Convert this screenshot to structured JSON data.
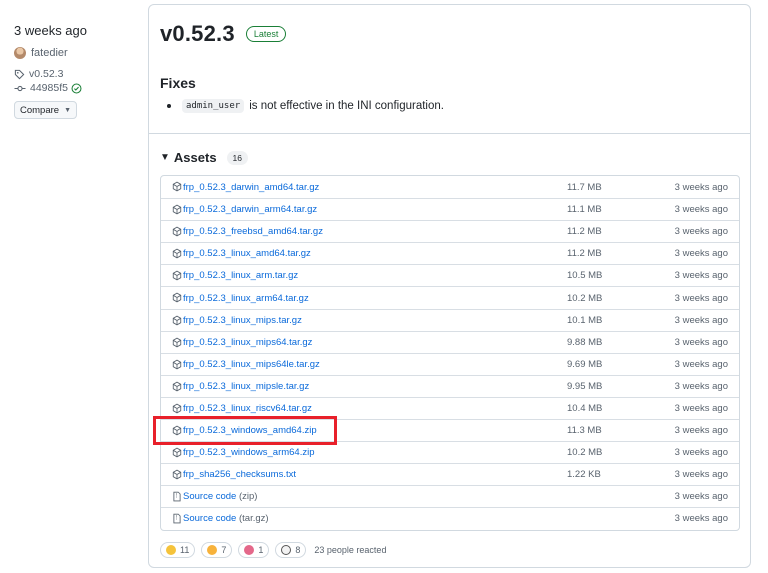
{
  "sidebar": {
    "time": "3 weeks ago",
    "author": "fatedier",
    "tag": "v0.52.3",
    "commit": "44985f5",
    "compare_label": "Compare"
  },
  "release": {
    "version": "v0.52.3",
    "latest_badge": "Latest",
    "section_title": "Fixes",
    "fix_code": "admin_user",
    "fix_text": "is not effective in the INI configuration."
  },
  "assets": {
    "title": "Assets",
    "count": "16",
    "rows": [
      {
        "name": "frp_0.52.3_darwin_amd64.tar.gz",
        "sub": "",
        "size": "11.7 MB",
        "when": "3 weeks ago",
        "icon": "package-icon"
      },
      {
        "name": "frp_0.52.3_darwin_arm64.tar.gz",
        "sub": "",
        "size": "11.1 MB",
        "when": "3 weeks ago",
        "icon": "package-icon"
      },
      {
        "name": "frp_0.52.3_freebsd_amd64.tar.gz",
        "sub": "",
        "size": "11.2 MB",
        "when": "3 weeks ago",
        "icon": "package-icon"
      },
      {
        "name": "frp_0.52.3_linux_amd64.tar.gz",
        "sub": "",
        "size": "11.2 MB",
        "when": "3 weeks ago",
        "icon": "package-icon"
      },
      {
        "name": "frp_0.52.3_linux_arm.tar.gz",
        "sub": "",
        "size": "10.5 MB",
        "when": "3 weeks ago",
        "icon": "package-icon"
      },
      {
        "name": "frp_0.52.3_linux_arm64.tar.gz",
        "sub": "",
        "size": "10.2 MB",
        "when": "3 weeks ago",
        "icon": "package-icon"
      },
      {
        "name": "frp_0.52.3_linux_mips.tar.gz",
        "sub": "",
        "size": "10.1 MB",
        "when": "3 weeks ago",
        "icon": "package-icon"
      },
      {
        "name": "frp_0.52.3_linux_mips64.tar.gz",
        "sub": "",
        "size": "9.88 MB",
        "when": "3 weeks ago",
        "icon": "package-icon"
      },
      {
        "name": "frp_0.52.3_linux_mips64le.tar.gz",
        "sub": "",
        "size": "9.69 MB",
        "when": "3 weeks ago",
        "icon": "package-icon"
      },
      {
        "name": "frp_0.52.3_linux_mipsle.tar.gz",
        "sub": "",
        "size": "9.95 MB",
        "when": "3 weeks ago",
        "icon": "package-icon"
      },
      {
        "name": "frp_0.52.3_linux_riscv64.tar.gz",
        "sub": "",
        "size": "10.4 MB",
        "when": "3 weeks ago",
        "icon": "package-icon"
      },
      {
        "name": "frp_0.52.3_windows_amd64.zip",
        "sub": "",
        "size": "11.3 MB",
        "when": "3 weeks ago",
        "icon": "package-icon"
      },
      {
        "name": "frp_0.52.3_windows_arm64.zip",
        "sub": "",
        "size": "10.2 MB",
        "when": "3 weeks ago",
        "icon": "package-icon"
      },
      {
        "name": "frp_sha256_checksums.txt",
        "sub": "",
        "size": "1.22 KB",
        "when": "3 weeks ago",
        "icon": "package-icon"
      },
      {
        "name": "Source code",
        "sub": "(zip)",
        "size": "",
        "when": "3 weeks ago",
        "icon": "file-zip-icon"
      },
      {
        "name": "Source code",
        "sub": "(tar.gz)",
        "size": "",
        "when": "3 weeks ago",
        "icon": "file-zip-icon"
      }
    ]
  },
  "reactions": {
    "items": [
      {
        "name": "thumbs-up",
        "count": "11",
        "color": "#f5c33b"
      },
      {
        "name": "laugh",
        "count": "7",
        "color": "#f7b23b"
      },
      {
        "name": "party",
        "count": "1",
        "color": "#e4688a"
      },
      {
        "name": "eyes",
        "count": "8",
        "color": "#f2f2f2"
      }
    ],
    "summary": "23 people reacted"
  },
  "colors": {
    "link": "#0969da",
    "latest": "#1a7f37",
    "highlight": "#e8202a"
  }
}
